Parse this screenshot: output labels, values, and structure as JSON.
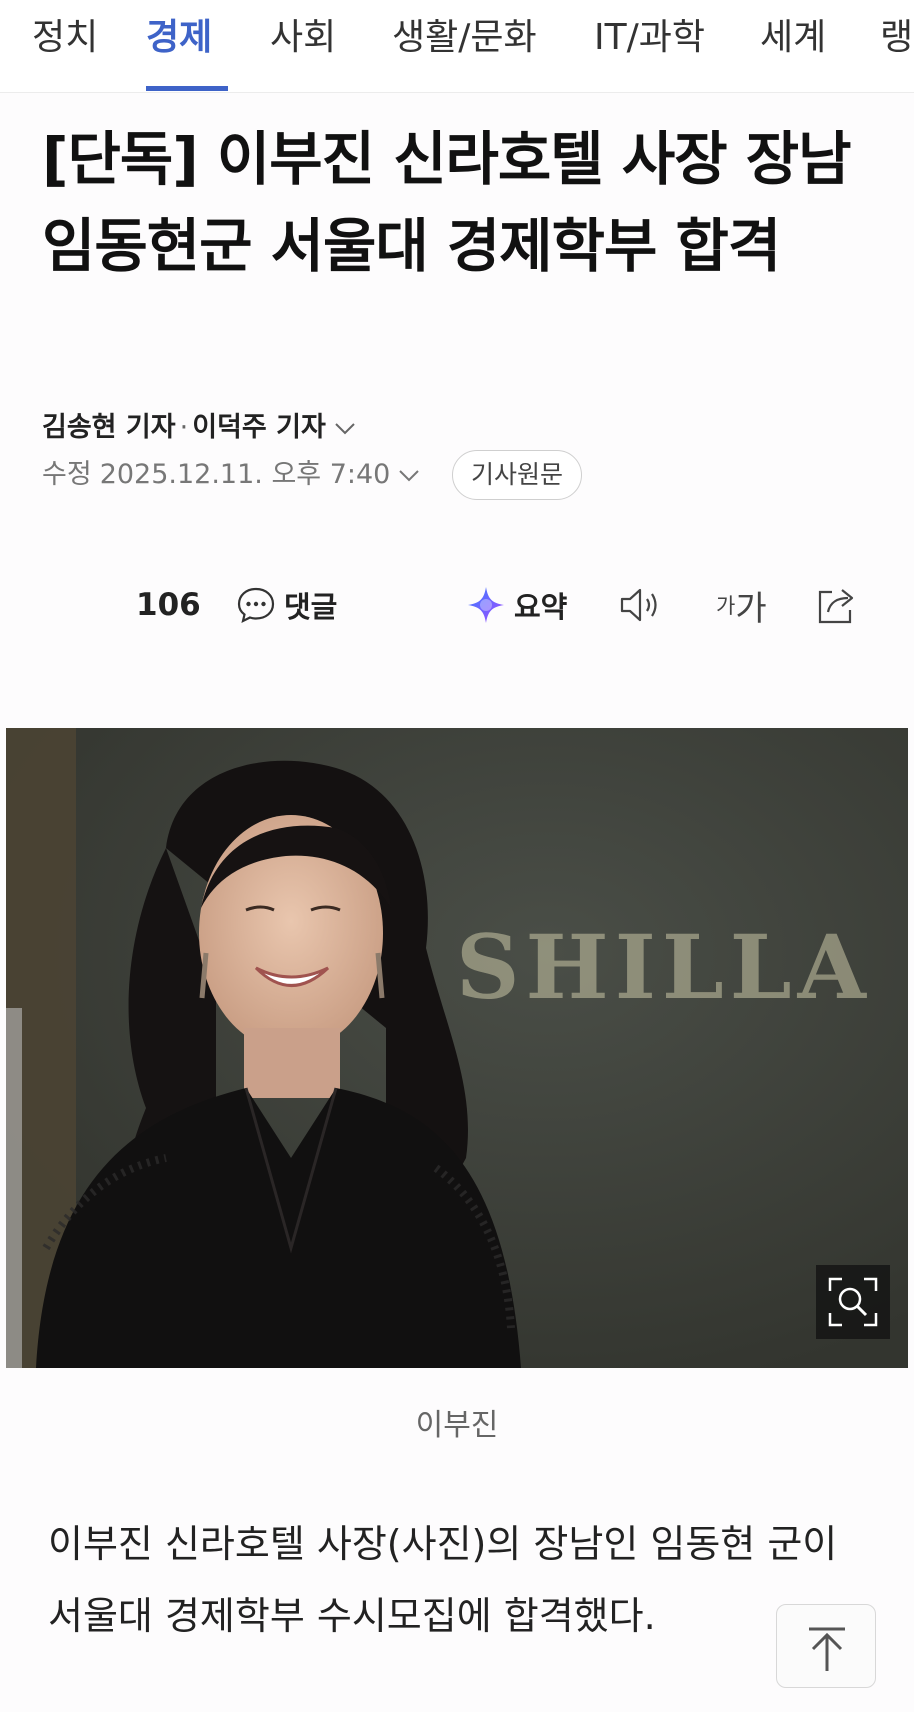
{
  "nav": {
    "tabs": [
      {
        "label": "정치",
        "active": false
      },
      {
        "label": "경제",
        "active": true
      },
      {
        "label": "사회",
        "active": false
      },
      {
        "label": "생활/문화",
        "active": false
      },
      {
        "label": "IT/과학",
        "active": false
      },
      {
        "label": "세계",
        "active": false
      },
      {
        "label": "랭",
        "active": false
      }
    ]
  },
  "article": {
    "headline": "[단독] 이부진 신라호텔 사장 장남 임동현군 서울대 경제학부 합격",
    "reporter1": "김송현 기자",
    "byline_sep": "·",
    "reporter2": "이덕주 기자",
    "modified_label": "수정",
    "modified_datetime": "2025.12.11. 오후 7:40",
    "original_button": "기사원문",
    "photo_sign_text": "SHILLA",
    "caption": "이부진",
    "body": "이부진 신라호텔 사장(사진)의 장남인 임동현 군이 서울대 경제학부 수시모집에 합격했다."
  },
  "toolbar": {
    "reaction_count": "106",
    "comment_label": "댓글",
    "summary_label": "요약",
    "font_small": "가",
    "font_large": "가"
  },
  "icons": {
    "comment": "comment-bubble-icon",
    "summary": "ai-summary-sparkle-icon",
    "audio": "speaker-icon",
    "share": "share-icon",
    "zoom": "zoom-magnifier-icon",
    "top": "arrow-up-icon"
  },
  "colors": {
    "accent": "#3e63c8",
    "summary_gradient": [
      "#3a7bff",
      "#a34dff"
    ]
  }
}
